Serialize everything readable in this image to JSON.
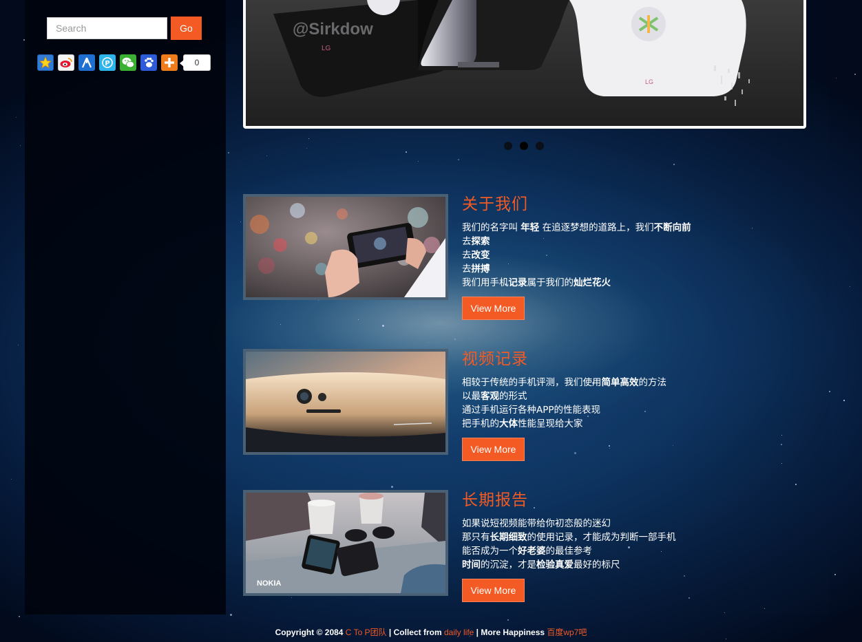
{
  "search": {
    "placeholder": "Search",
    "button_label": "Go"
  },
  "share": {
    "icons": [
      "qzone-icon",
      "weibo-icon",
      "renren-icon",
      "pengyou-icon",
      "wechat-icon",
      "baidu-icon",
      "more-icon"
    ],
    "count": "0"
  },
  "slider": {
    "watermark": "@Sirkdow",
    "brand": "LG",
    "dots": 3,
    "active_dot": 1
  },
  "features": [
    {
      "title": "关于我们",
      "lines": [
        [
          {
            "t": "我们的名字叫 "
          },
          {
            "t": "年轻",
            "b": true
          },
          {
            "t": " 在追逐梦想的道路上，我们"
          },
          {
            "t": "不断向前",
            "b": true
          }
        ],
        [
          {
            "t": "去"
          },
          {
            "t": "探索",
            "b": true
          }
        ],
        [
          {
            "t": "去"
          },
          {
            "t": "改变",
            "b": true
          }
        ],
        [
          {
            "t": "去"
          },
          {
            "t": "拼搏",
            "b": true
          }
        ],
        [
          {
            "t": "我们用手机"
          },
          {
            "t": "记录",
            "b": true
          },
          {
            "t": "属于我们的"
          },
          {
            "t": "灿烂花火",
            "b": true
          }
        ]
      ],
      "button": "View More"
    },
    {
      "title": "视频记录",
      "lines": [
        [
          {
            "t": "相较于传统的手机评测，我们使用"
          },
          {
            "t": "简单高效",
            "b": true
          },
          {
            "t": "的方法"
          }
        ],
        [
          {
            "t": "以最"
          },
          {
            "t": "客观",
            "b": true
          },
          {
            "t": "的形式"
          }
        ],
        [
          {
            "t": "通过手机运行各种APP的性能表现"
          }
        ],
        [
          {
            "t": "把手机的"
          },
          {
            "t": "大体",
            "b": true
          },
          {
            "t": "性能呈现给大家"
          }
        ]
      ],
      "button": "View More"
    },
    {
      "title": "长期报告",
      "lines": [
        [
          {
            "t": "如果说短视频能带给你初恋般的迷幻"
          }
        ],
        [
          {
            "t": "那只有"
          },
          {
            "t": "长期细致",
            "b": true
          },
          {
            "t": "的使用记录，才能成为判断一部手机"
          }
        ],
        [
          {
            "t": "能否成为一个"
          },
          {
            "t": "好老婆",
            "b": true
          },
          {
            "t": "的最佳参考"
          }
        ],
        [
          {
            "t": "时间",
            "b": true
          },
          {
            "t": "的沉淀，才是"
          },
          {
            "t": "检验真爱",
            "b": true
          },
          {
            "t": "最好的标尺"
          }
        ]
      ],
      "button": "View More",
      "image_text": "NOKIA"
    }
  ],
  "footer": {
    "prefix": "Copyright © 2084 ",
    "team": "C To P团队",
    "mid1": " | Collect from ",
    "link1": "daily life",
    "mid2": " | More Happiness ",
    "link2": "百度wp7吧"
  },
  "colors": {
    "accent": "#f35a24",
    "thumb_border": "#4a6175",
    "sidebar_bg": "#00040e"
  }
}
